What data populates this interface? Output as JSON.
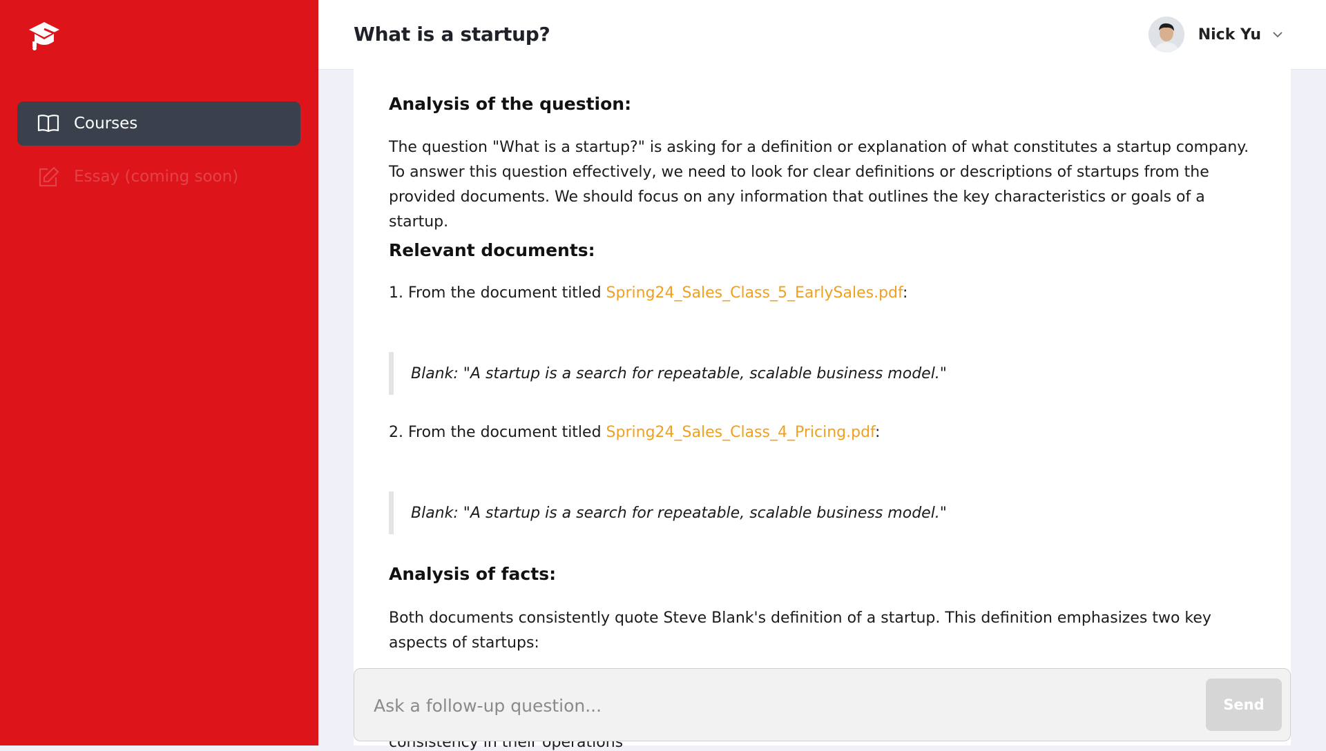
{
  "sidebar": {
    "logo_icon": "graduation-cap-icon",
    "items": [
      {
        "label": "Courses",
        "icon": "book-open-icon",
        "active": true
      },
      {
        "label": "Essay (coming soon)",
        "icon": "edit-icon",
        "active": false
      }
    ]
  },
  "header": {
    "title": "What is a startup?",
    "user_name": "Nick Yu",
    "menu_icon": "chevron-down-icon"
  },
  "content": {
    "analysis_heading": "Analysis of the question:",
    "analysis_text": "The question \"What is a startup?\" is asking for a definition or explanation of what constitutes a startup company. To answer this question effectively, we need to look for clear definitions or descriptions of startups from the provided documents. We should focus on any information that outlines the key characteristics or goals of a startup.",
    "docs_heading": "Relevant documents:",
    "docs": [
      {
        "prefix": "1. From the document titled ",
        "link": "Spring24_Sales_Class_5_EarlySales.pdf",
        "suffix": ":",
        "quote": "Blank: \"A startup is a search for repeatable, scalable business model.\""
      },
      {
        "prefix": "2. From the document titled ",
        "link": "Spring24_Sales_Class_4_Pricing.pdf",
        "suffix": ":",
        "quote": "Blank: \"A startup is a search for repeatable, scalable business model.\""
      }
    ],
    "facts_heading": "Analysis of facts:",
    "facts_text": "Both documents consistently quote Steve Blank's definition of a startup. This definition emphasizes two key aspects of startups:",
    "cut_text": "consistency in their operations"
  },
  "ask": {
    "placeholder": "Ask a follow-up question...",
    "value": "",
    "send_label": "Send"
  },
  "colors": {
    "sidebar_bg": "#dd151b",
    "active_nav_bg": "#3b414c",
    "link": "#f0a020"
  }
}
